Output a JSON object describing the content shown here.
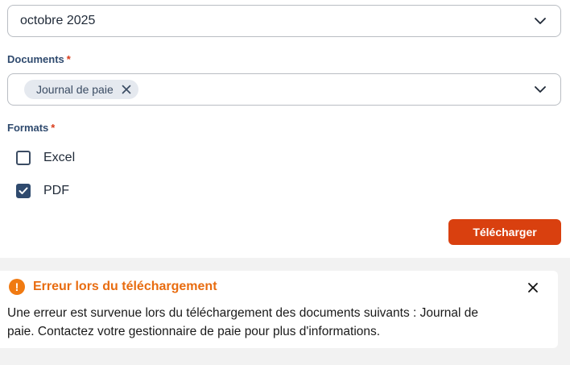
{
  "period_select": {
    "value": "octobre 2025"
  },
  "documents": {
    "label": "Documents",
    "required_mark": "*",
    "selected_chips": [
      {
        "label": "Journal de paie"
      }
    ]
  },
  "formats": {
    "label": "Formats",
    "required_mark": "*",
    "options": [
      {
        "label": "Excel",
        "checked": false
      },
      {
        "label": "PDF",
        "checked": true
      }
    ]
  },
  "download_button": {
    "label": "Télécharger"
  },
  "alert": {
    "title": "Erreur lors du téléchargement",
    "message": "Une erreur est survenue lors du téléchargement des documents suivants : Journal de paie. Contactez votre gestionnaire de paie pour plus d'informations.",
    "icon": "exclamation-icon"
  },
  "colors": {
    "primary_button": "#d9400f",
    "alert_warning": "#f07a12",
    "label_text": "#2f4a6e",
    "required": "#d93b1a"
  }
}
